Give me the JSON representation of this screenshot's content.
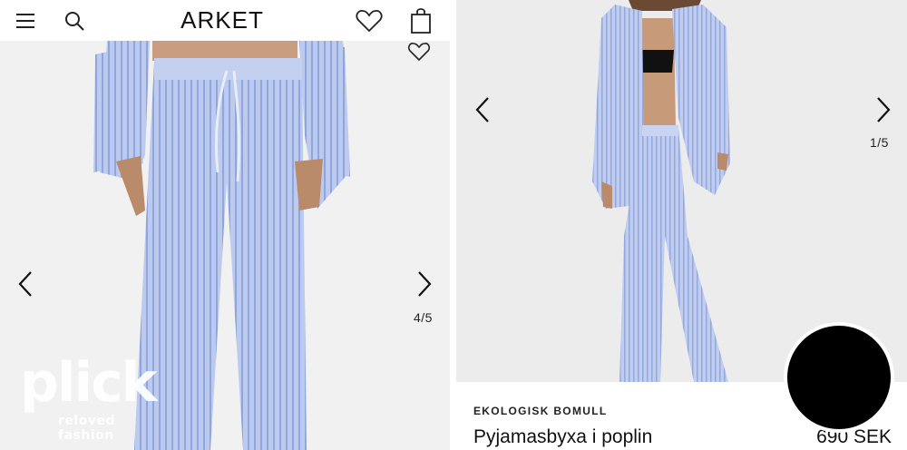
{
  "left_panel": {
    "header": {
      "menu_icon": "hamburger-icon",
      "search_icon": "search-icon",
      "brand": "ARKET",
      "wishlist_icon": "heart-icon",
      "bag_icon": "shopping-bag-icon"
    },
    "gallery": {
      "counter": "4/5",
      "prev_icon": "chevron-left-icon",
      "next_icon": "chevron-right-icon",
      "favorite_icon": "heart-icon"
    },
    "watermark": {
      "logo": "plick",
      "tagline": "reloved fashion"
    }
  },
  "right_panel": {
    "gallery": {
      "counter": "1/5",
      "prev_icon": "chevron-left-icon",
      "next_icon": "chevron-right-icon"
    },
    "product": {
      "eyebrow": "EKOLOGISK BOMULL",
      "name": "Pyjamasbyxa i poplin",
      "price": "690 SEK"
    }
  },
  "colors": {
    "fabric": "#b9c6ec",
    "stripe": "#8ea3dc",
    "skin": "#c79a7a",
    "background": "#f1f1f1"
  }
}
